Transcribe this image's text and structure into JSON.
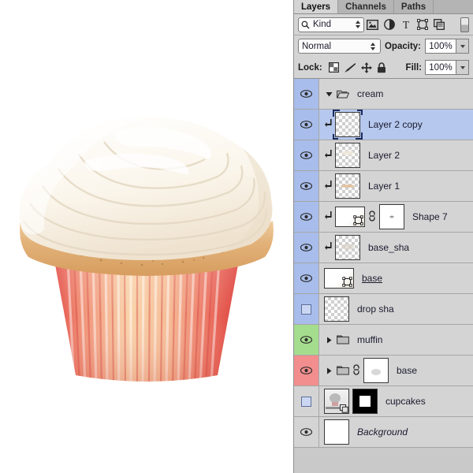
{
  "panel": {
    "tabs": [
      {
        "label": "Layers",
        "active": true
      },
      {
        "label": "Channels",
        "active": false
      },
      {
        "label": "Paths",
        "active": false
      }
    ],
    "filter": {
      "kind_label": "Kind",
      "search_icon": "search-icon",
      "icons": [
        "pixel-layer-filter-icon",
        "adjustment-layer-filter-icon",
        "type-layer-filter-icon",
        "shape-layer-filter-icon",
        "smart-object-filter-icon"
      ],
      "toggle": "filter-enable-toggle"
    },
    "blend": {
      "mode": "Normal",
      "opacity_label": "Opacity:",
      "opacity_value": "100%"
    },
    "lock": {
      "label": "Lock:",
      "icons": [
        "lock-transparent-pixels-icon",
        "lock-image-pixels-icon",
        "lock-position-icon",
        "lock-all-icon"
      ],
      "fill_label": "Fill:",
      "fill_value": "100%"
    },
    "layers": [
      {
        "name": "cream",
        "type": "group",
        "expanded": true,
        "visible": true,
        "selected": false,
        "color": "blue",
        "indent": 0
      },
      {
        "name": "Layer 2 copy",
        "type": "pixel",
        "visible": true,
        "selected": true,
        "clipped": true,
        "color": "blue",
        "indent": 1
      },
      {
        "name": "Layer 2",
        "type": "pixel",
        "visible": true,
        "selected": false,
        "clipped": true,
        "color": "blue",
        "indent": 1
      },
      {
        "name": "Layer 1",
        "type": "pixel",
        "visible": true,
        "selected": false,
        "clipped": true,
        "color": "blue",
        "indent": 1
      },
      {
        "name": "Shape 7",
        "type": "shape",
        "visible": true,
        "selected": false,
        "clipped": true,
        "linked": true,
        "has_mask": true,
        "color": "blue",
        "indent": 1
      },
      {
        "name": "base_sha",
        "type": "pixel",
        "visible": true,
        "selected": false,
        "clipped": true,
        "color": "blue",
        "indent": 1
      },
      {
        "name": "base",
        "type": "shape",
        "visible": true,
        "selected": false,
        "underlined": true,
        "color": "blue",
        "indent": 0
      },
      {
        "name": "drop sha",
        "type": "pixel",
        "visible": false,
        "selected": false,
        "color": "blue",
        "indent": 0
      },
      {
        "name": "muffin",
        "type": "group",
        "expanded": false,
        "visible": true,
        "selected": false,
        "color": "green",
        "indent": 0
      },
      {
        "name": "base",
        "type": "group",
        "expanded": false,
        "visible": true,
        "selected": false,
        "linked": true,
        "has_mask": true,
        "color": "red",
        "indent": 0
      },
      {
        "name": "cupcakes",
        "type": "smart",
        "visible": false,
        "selected": false,
        "has_black_mask": true,
        "color": "none",
        "indent": 0
      },
      {
        "name": "Background",
        "type": "background",
        "visible": true,
        "selected": false,
        "italic": true,
        "color": "none",
        "indent": 0
      }
    ]
  },
  "canvas": {
    "artwork": "cupcake-illustration",
    "colors": {
      "frosting": "#fbf8f2",
      "cake": "#e4b278",
      "wrapper_light": "#f7c9a8",
      "wrapper_dark": "#e8493f"
    }
  }
}
